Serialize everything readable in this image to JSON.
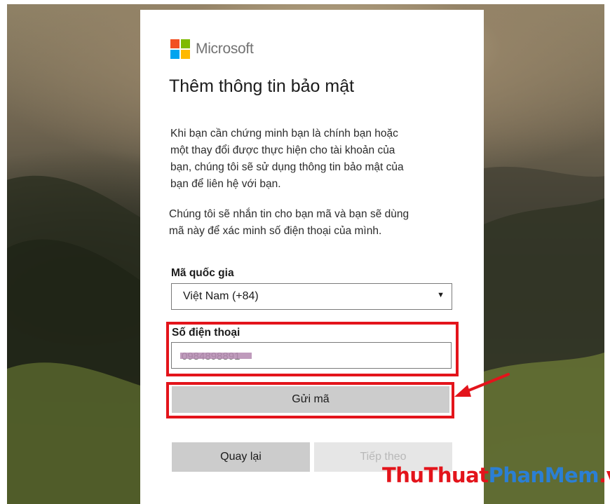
{
  "brand": {
    "name": "Microsoft",
    "logo_colors": [
      "#f25022",
      "#7fba00",
      "#00a4ef",
      "#ffb900"
    ]
  },
  "page": {
    "title": "Thêm thông tin bảo mật",
    "intro_lines": [
      "Khi bạn cần chứng minh bạn là chính bạn hoặc",
      "một thay đổi được thực hiện cho tài khoản của",
      "bạn, chúng tôi sẽ sử dụng thông tin bảo mật của",
      "bạn để liên hệ với bạn."
    ],
    "sms_lines": [
      "Chúng tôi sẽ nhắn tin cho bạn mã và bạn sẽ dùng",
      "mã này để xác minh số điện thoại của mình."
    ]
  },
  "form": {
    "country_label": "Mã quốc gia",
    "country_value": "Việt Nam (+84)",
    "phone_label": "Số điện thoại",
    "phone_value": "0984898891",
    "send_code_label": "Gửi mã"
  },
  "nav": {
    "back_label": "Quay lại",
    "next_label": "Tiếp theo"
  },
  "watermark": {
    "part1": "ThuThuat",
    "part2": "PhanMem",
    "part3": ".vn"
  },
  "colors": {
    "highlight": "#e3141b",
    "button_bg": "#cccccc",
    "disabled_bg": "#e6e6e6"
  }
}
